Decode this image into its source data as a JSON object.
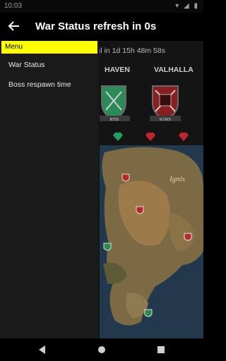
{
  "status_bar": {
    "time": "10:03",
    "icons": "▾ ◢ ▮"
  },
  "app_bar": {
    "title": "War Status refresh in 0s"
  },
  "content": {
    "subtitle": "il in 1d 15h 48m 58s",
    "factions": [
      {
        "name": "HAVEN",
        "crest_label": "RTIS",
        "color": "#1e7a4a"
      },
      {
        "name": "VALHALLA",
        "crest_label": "IGNIS",
        "color": "#9a1f24"
      }
    ],
    "map": {
      "region_label": "Ignis"
    }
  },
  "drawer": {
    "header": "Menu",
    "items": [
      {
        "label": "War Status"
      },
      {
        "label": "Boss respawn time"
      }
    ],
    "accent": "#ffff00"
  }
}
